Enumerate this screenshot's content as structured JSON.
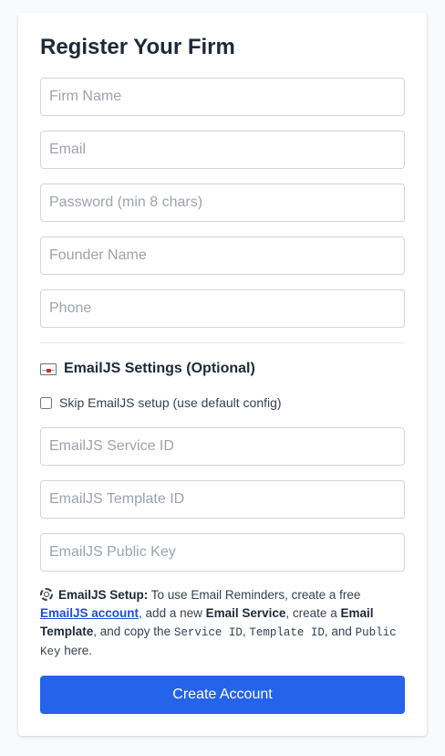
{
  "form": {
    "title": "Register Your Firm",
    "fields": {
      "firm_name": {
        "placeholder": "Firm Name",
        "value": ""
      },
      "email": {
        "placeholder": "Email",
        "value": ""
      },
      "password": {
        "placeholder": "Password (min 8 chars)",
        "value": ""
      },
      "founder_name": {
        "placeholder": "Founder Name",
        "value": ""
      },
      "phone": {
        "placeholder": "Phone",
        "value": ""
      }
    }
  },
  "emailjs": {
    "section_title": "EmailJS Settings (Optional)",
    "section_icon": "envelope-icon",
    "skip_label": "Skip EmailJS setup (use default config)",
    "skip_checked": false,
    "fields": {
      "service_id": {
        "placeholder": "EmailJS Service ID",
        "value": ""
      },
      "template_id": {
        "placeholder": "EmailJS Template ID",
        "value": ""
      },
      "public_key": {
        "placeholder": "EmailJS Public Key",
        "value": ""
      }
    },
    "note": {
      "icon": "gear-icon",
      "heading": "EmailJS Setup:",
      "text_1": " To use Email Reminders, create a free ",
      "link_text": "EmailJS account",
      "text_2": ", add a new ",
      "bold_service": "Email Service",
      "text_3": ", create a ",
      "bold_template": "Email Template",
      "text_4": ", and copy the ",
      "code_service": "Service ID",
      "text_5": ", ",
      "code_template": "Template ID",
      "text_6": ", and ",
      "code_key": "Public Key",
      "text_7": " here."
    }
  },
  "submit": {
    "label": "Create Account"
  },
  "colors": {
    "accent": "#2563eb",
    "link": "#1d4ed8",
    "border": "#d1d5db"
  }
}
